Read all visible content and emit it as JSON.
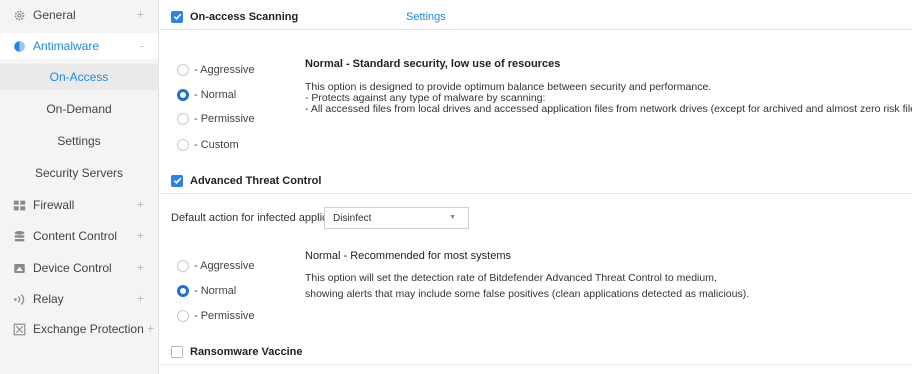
{
  "sidebar": {
    "items": [
      {
        "label": "General",
        "icon": "gear-icon",
        "expand": "+"
      },
      {
        "label": "Antimalware",
        "icon": "shield-icon",
        "expand": "-"
      },
      {
        "label": "Firewall",
        "icon": "firewall-icon",
        "expand": "+"
      },
      {
        "label": "Content Control",
        "icon": "database-icon",
        "expand": "+"
      },
      {
        "label": "Device Control",
        "icon": "device-icon",
        "expand": "+"
      },
      {
        "label": "Relay",
        "icon": "relay-icon",
        "expand": "+"
      },
      {
        "label": "Exchange Protection",
        "icon": "exchange-icon",
        "expand": "+"
      }
    ],
    "subitems": [
      {
        "label": "On-Access"
      },
      {
        "label": "On-Demand"
      },
      {
        "label": "Settings"
      },
      {
        "label": "Security Servers"
      }
    ]
  },
  "on_access": {
    "title": "On-access Scanning",
    "settings_link": "Settings",
    "checked": true,
    "radios": [
      "- Aggressive",
      "- Normal",
      "- Permissive",
      "- Custom"
    ],
    "selected": "- Normal",
    "desc_title": "Normal - Standard security, low use of resources",
    "desc_lines": [
      "This option is designed to provide optimum balance between security and performance.",
      "- Protects against any type of malware by scanning:",
      "- All accessed files from local drives and accessed application files from network drives (except for archived and almost zero risk files)."
    ]
  },
  "atc": {
    "title": "Advanced Threat Control",
    "checked": true,
    "default_action_label": "Default action for infected applications:",
    "default_action_value": "Disinfect",
    "radios": [
      "- Aggressive",
      "- Normal",
      "- Permissive"
    ],
    "selected": "- Normal",
    "desc_title": "Normal - Recommended for most systems",
    "desc_lines": [
      "This option will set the detection rate of Bitdefender Advanced Threat Control to medium,",
      "showing alerts that may include some false positives (clean applications detected as malicious)."
    ]
  },
  "ransomware": {
    "title": "Ransomware Vaccine",
    "checked": false
  },
  "colors": {
    "accent": "#1e88e5",
    "checkbox": "#2f80ed",
    "sidebar_bg": "#f4f4f4"
  }
}
